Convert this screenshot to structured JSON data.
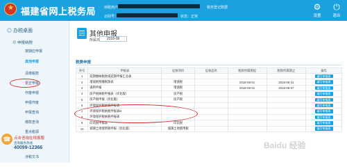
{
  "header": {
    "title": "福建省网上税务局",
    "user_label": "纳税用户：",
    "tax_id_label": "识别号：",
    "status_label": "状态：正常",
    "reg_label": "税务登记数据",
    "settings_label": "设置",
    "exit_label": "退出"
  },
  "sidebar": {
    "home_label": "办税桌面",
    "group_label": "申报纳税",
    "items": [
      {
        "label": "按期应申报",
        "active": false
      },
      {
        "label": "其他申报",
        "active": true
      },
      {
        "label": "清缴税款",
        "active": false
      },
      {
        "label": "更正申报",
        "active": false
      },
      {
        "label": "作废申报",
        "active": false
      },
      {
        "label": "申报作废",
        "active": false
      },
      {
        "label": "申报查询",
        "active": false
      },
      {
        "label": "缴款查询",
        "active": false
      },
      {
        "label": "重点税源",
        "active": false
      }
    ],
    "hotline_link": "点击咨询在线客服",
    "hotline_label": "咨询服务热线",
    "hotline_number": "40099-12366",
    "bottom_label": "涉税文书"
  },
  "main": {
    "page_title": "其他申报",
    "period_label": "所属日期",
    "period_value": "2018-08",
    "section_title": "税费申报",
    "columns": [
      "序号",
      "申报表",
      "征收项目",
      "征收品目",
      "税款所属期起",
      "税款所属期止",
      "操作"
    ],
    "rows": [
      {
        "no": "1",
        "form": "延期缴纳税款或延期申报汇总表",
        "item": "",
        "subitem": "",
        "start": "",
        "end": "",
        "action": "填写申报表"
      },
      {
        "no": "2",
        "form": "增值税预缴税款表",
        "item": "增值税",
        "subitem": "",
        "start": "2018-08-01",
        "end": "2018-08-31",
        "action": "填写申报表"
      },
      {
        "no": "3",
        "form": "通用申报",
        "item": "增值税",
        "subitem": "",
        "start": "2018-09-01",
        "end": "2018-09-07",
        "action": "填写申报表"
      },
      {
        "no": "4",
        "form": "房产税纳税申报表（优化版）",
        "item": "房产税",
        "subitem": "",
        "start": "",
        "end": "",
        "action": "填写申报表"
      },
      {
        "no": "5",
        "form": "房产税申报（优化版）",
        "item": "房产税",
        "subitem": "",
        "start": "",
        "end": "",
        "action": "填写申报表"
      },
      {
        "no": "6",
        "form": "环境保护税纳税申报表",
        "item": "",
        "subitem": "",
        "start": "",
        "end": "",
        "action": "填写申报表"
      },
      {
        "no": "7",
        "form": "环境保护税纳税申报表B",
        "item": "",
        "subitem": "",
        "start": "",
        "end": "",
        "action": "填写申报表"
      },
      {
        "no": "8",
        "form": "环境保护税纳税申报表",
        "item": "",
        "subitem": "",
        "start": "",
        "end": "",
        "action": "填写申报表"
      },
      {
        "no": "9",
        "form": "印花税申报表",
        "item": "印花税",
        "subitem": "",
        "start": "",
        "end": "",
        "action": "填写申报表"
      },
      {
        "no": "10",
        "form": "城镇土地使用税申报（优化版）",
        "item": "城镇土地使用税",
        "subitem": "",
        "start": "",
        "end": "",
        "action": "填写申报表"
      }
    ]
  },
  "watermark": "Baidu 经验"
}
